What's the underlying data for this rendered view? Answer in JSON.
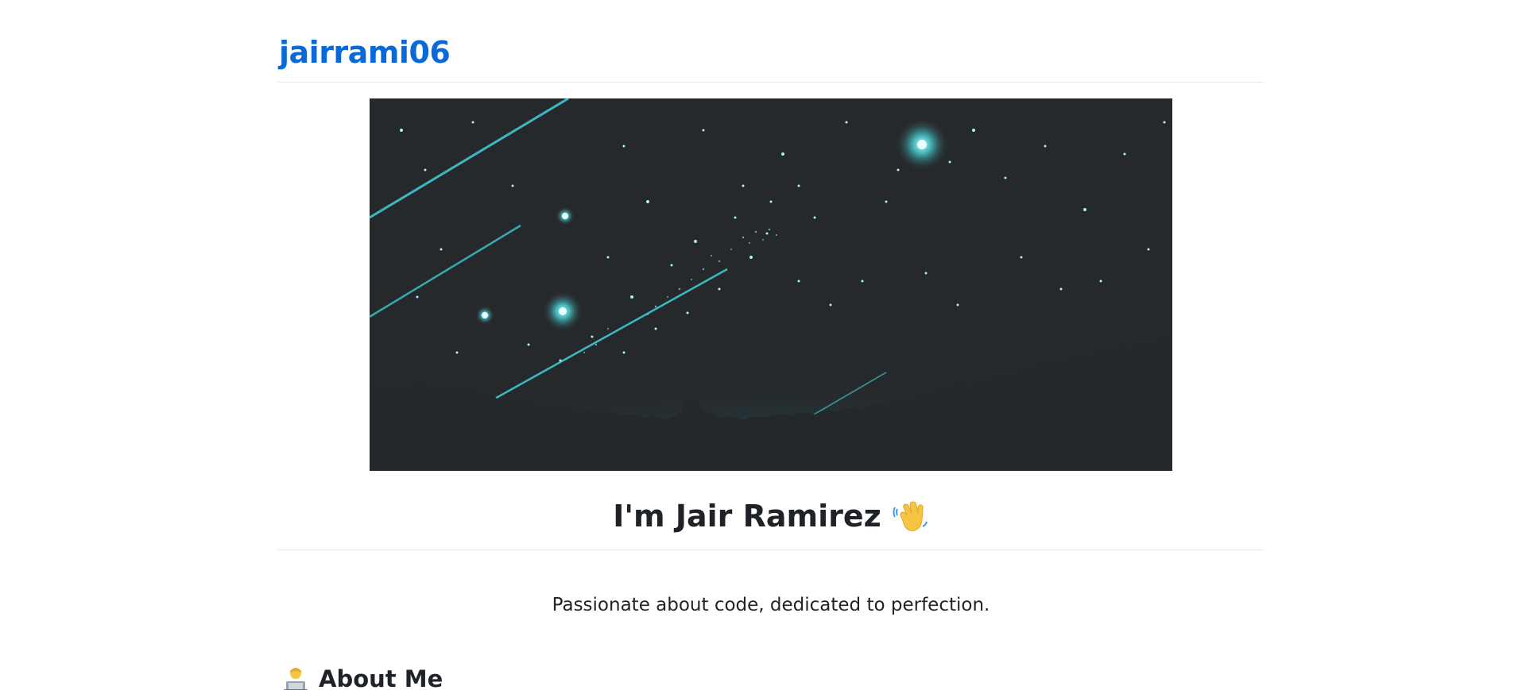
{
  "header": {
    "repo_name": "jairrami06"
  },
  "banner": {
    "icon": "night-sky-banner",
    "colors": {
      "sky": "#26292b",
      "glow": "#2fd6e6",
      "silhouette": "#24282a"
    }
  },
  "hero": {
    "title": "I'm Jair Ramirez",
    "icon": "waving-hand-icon"
  },
  "tagline": "Passionate about code, dedicated to perfection.",
  "about": {
    "heading": "About Me",
    "icon": "technologist-icon"
  },
  "colors": {
    "link": "#0969da",
    "text": "#1f2328",
    "divider": "#e6e8eb"
  }
}
